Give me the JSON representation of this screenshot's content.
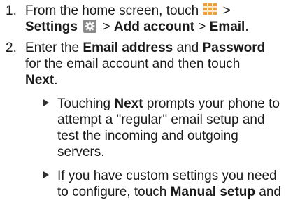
{
  "steps": [
    {
      "number": "1.",
      "line1": {
        "pre": "From the home screen, touch",
        "sep": ">"
      },
      "line2": {
        "settings": "Settings",
        "sep1": ">",
        "add_account": "Add account",
        "sep2": ">",
        "email": "Email",
        "end": "."
      }
    },
    {
      "number": "2.",
      "line1": {
        "pre": "Enter the ",
        "email_address": "Email address",
        "and": " and ",
        "password": "Password"
      },
      "line2": "for the email account and then touch",
      "line3": {
        "next": "Next",
        "end": "."
      }
    }
  ],
  "bullets": [
    {
      "line1": {
        "pre": "Touching ",
        "next": "Next",
        "post": " prompts your phone to"
      },
      "line2": "attempt a \"regular\" email setup and",
      "line3": "test the incoming and outgoing",
      "line4": "servers."
    },
    {
      "line1": "If you have custom settings you need",
      "line2": {
        "pre": "to configure, touch ",
        "manual_setup": "Manual setup",
        "post": " and"
      }
    }
  ],
  "icons": {
    "apps": "apps-grid-icon",
    "settings": "settings-gear-icon"
  },
  "colors": {
    "text": "#1a1a1a",
    "apps_icon": "#f0a030",
    "settings_icon_bg": "#8a8a8a"
  }
}
